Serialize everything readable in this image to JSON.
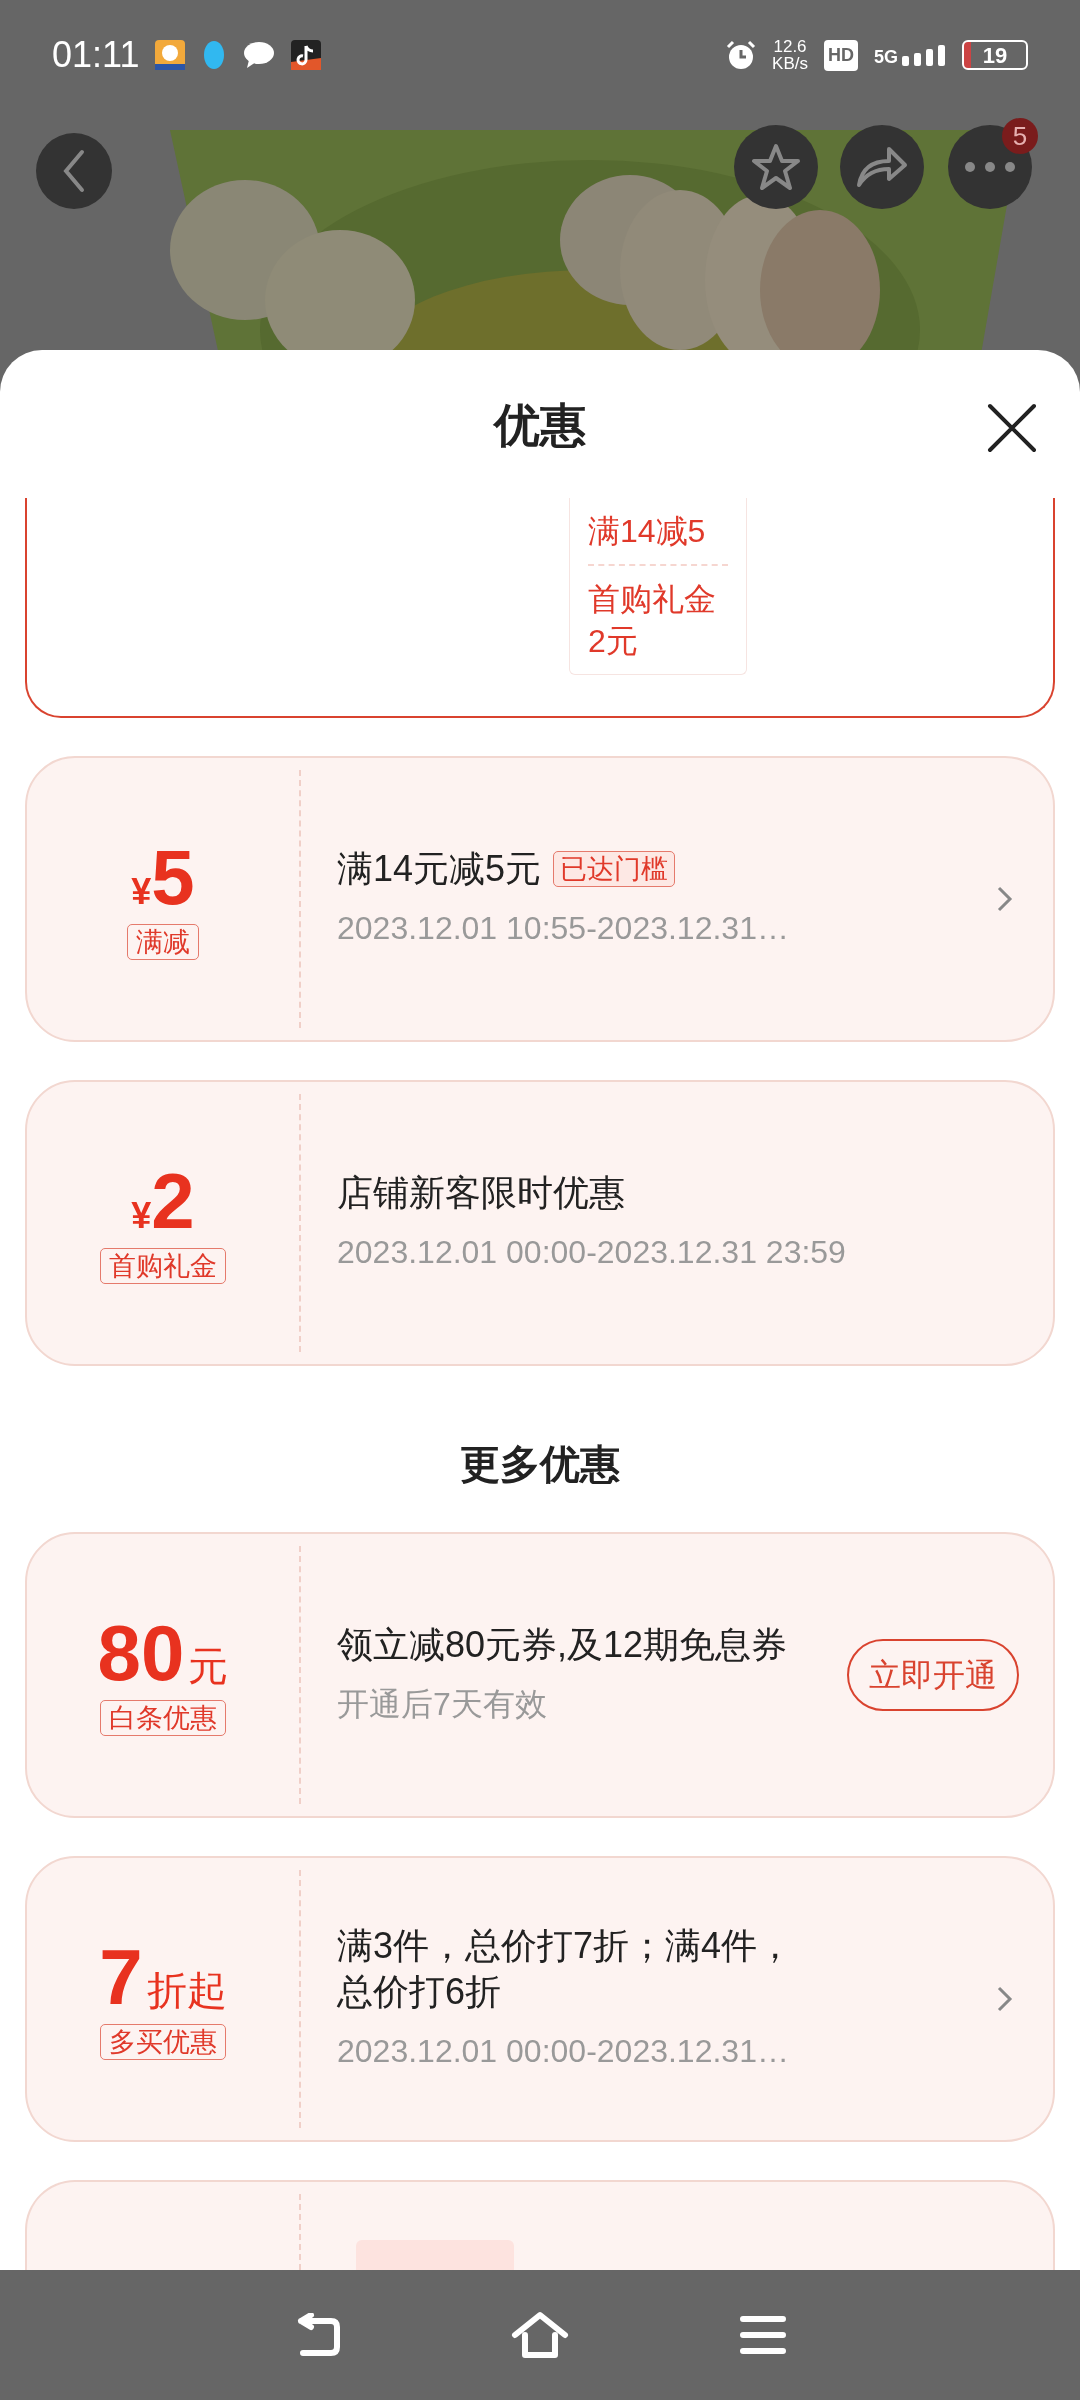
{
  "status_bar": {
    "time": "01:11",
    "speed": "12.6",
    "speed_unit": "KB/s",
    "hd": "HD",
    "network": "5G",
    "battery": "19"
  },
  "top_bar": {
    "more_badge": "5"
  },
  "sheet": {
    "title": "优惠"
  },
  "summary_list": [
    "满14减5",
    "首购礼金2元"
  ],
  "coupons": [
    {
      "kind": "full",
      "currency": "¥",
      "amount": "5",
      "tag": "满减",
      "title": "满14元减5元",
      "badge": "已达门槛",
      "date": "2023.12.01 10:55-2023.12.31…",
      "action": {
        "kind": "chevron"
      }
    },
    {
      "kind": "full",
      "currency": "¥",
      "amount": "2",
      "tag": "首购礼金",
      "title": "店铺新客限时优惠",
      "date": "2023.12.01 00:00-2023.12.31 23:59"
    }
  ],
  "more_heading": "更多优惠",
  "more_coupons": [
    {
      "kind": "full",
      "amount": "80",
      "unit": "元",
      "tag": "白条优惠",
      "title": "领立减80元券,及12期免息券",
      "date": "开通后7天有效",
      "action": {
        "kind": "button",
        "label": "立即开通"
      }
    },
    {
      "kind": "full",
      "amount": "7",
      "unit": "折起",
      "tag": "多买优惠",
      "title": "满3件，总价打7折；满4件，总价打6折",
      "date": "2023.12.01 00:00-2023.12.31…",
      "action": {
        "kind": "chevron"
      }
    },
    {
      "kind": "partial"
    }
  ]
}
